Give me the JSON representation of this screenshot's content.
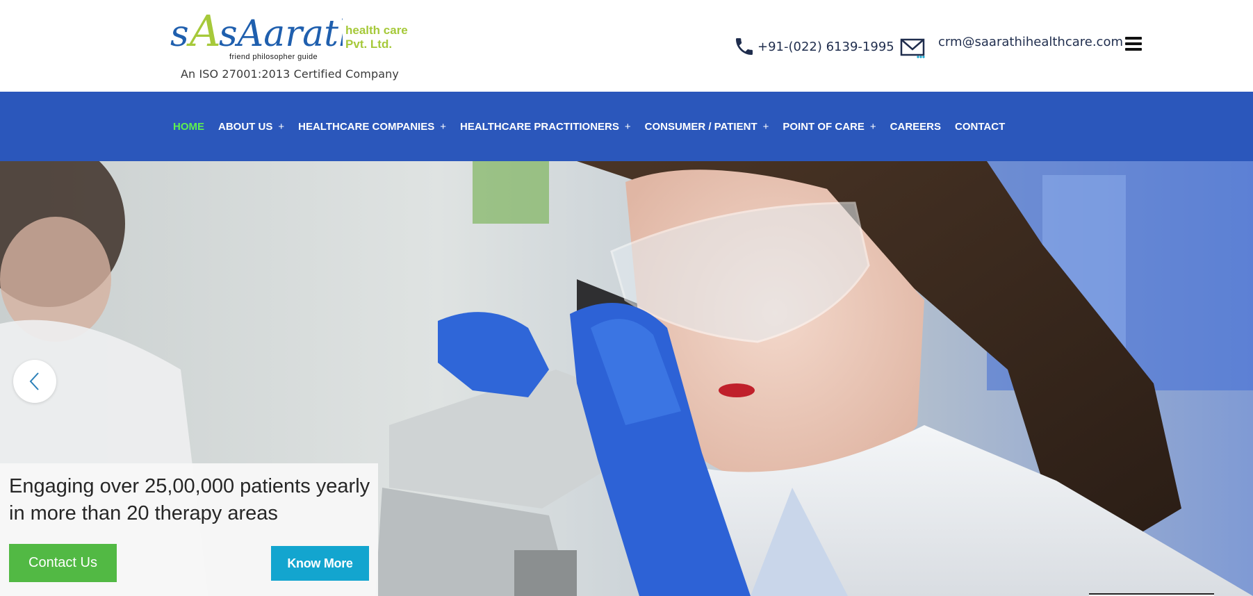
{
  "brand": {
    "logo_text": "sAarathi",
    "tagline": "friend   philosopher   guide",
    "suffix_line1": "health care",
    "suffix_line2": "Pvt. Ltd.",
    "iso_text": "An ISO 27001:2013 Certified Company"
  },
  "contact": {
    "phone": "+91-(022) 6139-1995",
    "email": "crm@saarathihealthcare.com",
    "phone_icon": "phone-icon",
    "email_icon": "mail-icon"
  },
  "menu_icon": "hamburger-menu-icon",
  "nav": {
    "items": [
      {
        "label": "HOME",
        "plus": "",
        "active": true
      },
      {
        "label": "ABOUT US",
        "plus": "+",
        "active": false
      },
      {
        "label": "HEALTHCARE COMPANIES",
        "plus": "+",
        "active": false
      },
      {
        "label": "HEALTHCARE PRACTITIONERS",
        "plus": "+",
        "active": false
      },
      {
        "label": "CONSUMER / PATIENT",
        "plus": "+",
        "active": false
      },
      {
        "label": "POINT OF CARE",
        "plus": "+",
        "active": false
      },
      {
        "label": "CAREERS",
        "plus": "",
        "active": false
      },
      {
        "label": "CONTACT",
        "plus": "",
        "active": false
      }
    ]
  },
  "hero": {
    "caption": "Engaging over 25,00,000 patients yearly in more than 20 therapy areas",
    "contact_button": "Contact Us",
    "know_more_button": "Know More",
    "prev_icon": "chevron-left-icon"
  },
  "colors": {
    "nav_bg": "#2b57bb",
    "nav_active": "#5df04f",
    "logo_blue": "#1f5fae",
    "logo_green": "#a6c93a",
    "contact_button": "#52b944",
    "know_more_button": "#13a5cf"
  }
}
